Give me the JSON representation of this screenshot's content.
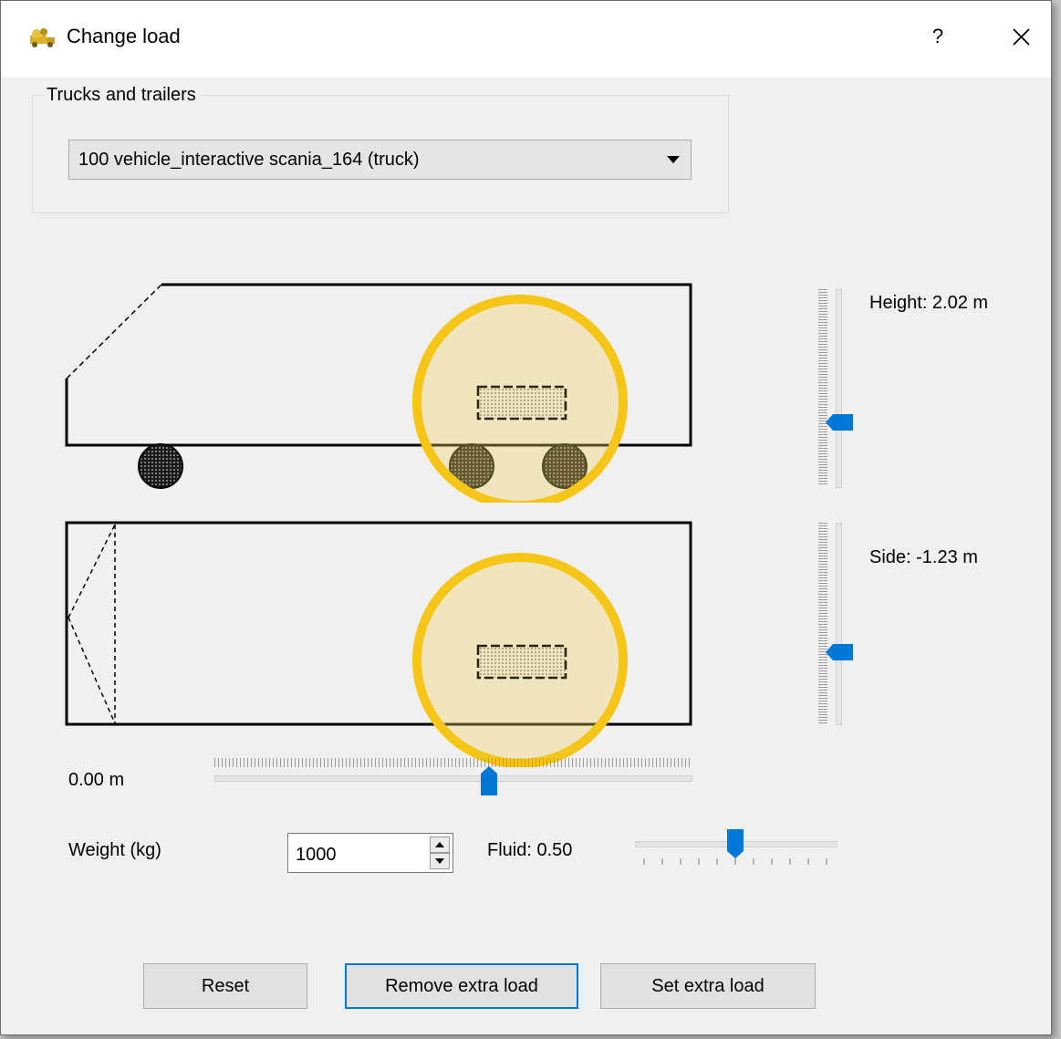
{
  "window": {
    "title": "Change load",
    "help_glyph": "?",
    "close_icon": "close-icon",
    "app_icon": "truck-cargo-icon"
  },
  "vehicles_group": {
    "title": "Trucks and trailers",
    "selected": "100 vehicle_interactive scania_164 (truck)"
  },
  "diagram": {
    "load_highlight_color": "#f5c518",
    "load_fill_color": "#f5ecc8",
    "wheel_count": 3
  },
  "height": {
    "label": "Height: 2.02 m",
    "slider_fraction": 0.69
  },
  "side": {
    "label": "Side: -1.23 m",
    "slider_fraction": 0.66
  },
  "position": {
    "label": "0.00 m",
    "slider_fraction": 0.58
  },
  "weight": {
    "label": "Weight (kg)",
    "value": "1000"
  },
  "fluid": {
    "label": "Fluid: 0.50",
    "slider_fraction": 0.5
  },
  "buttons": {
    "reset": "Reset",
    "remove": "Remove extra load",
    "set": "Set extra load"
  },
  "colors": {
    "accent": "#0078d7",
    "handle": "#0078d7"
  }
}
